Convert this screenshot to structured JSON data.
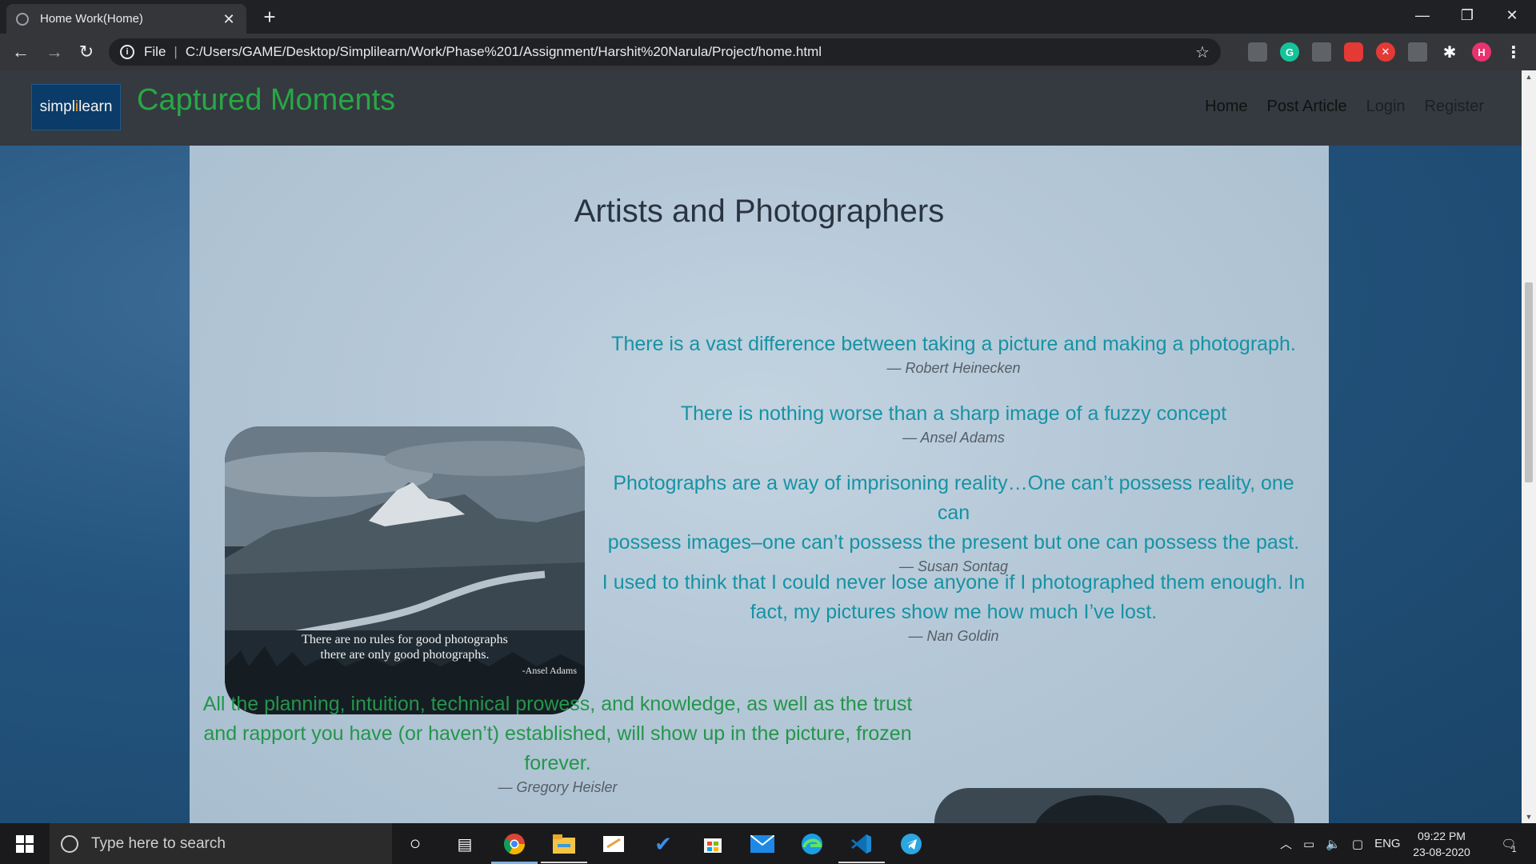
{
  "browser": {
    "tab_title": "Home Work(Home)",
    "tab_close": "✕",
    "new_tab": "+",
    "url_scheme": "File",
    "url": "C:/Users/GAME/Desktop/Simplilearn/Work/Phase%201/Assignment/Harshit%20Narula/Project/home.html",
    "profile_initial": "H",
    "minimize": "—",
    "restore": "❐",
    "close": "✕"
  },
  "site": {
    "logo_text_a": "simpl",
    "logo_text_b": "i",
    "logo_text_c": "learn",
    "brand": "Captured Moments",
    "nav": [
      {
        "label": "Home"
      },
      {
        "label": "Post Article"
      },
      {
        "label": "Login"
      },
      {
        "label": "Register"
      }
    ]
  },
  "main": {
    "title": "Artists and Photographers",
    "photo1_quote_line1": "There are no rules for good photographs",
    "photo1_quote_line2": "there are only good photographs.",
    "photo1_author": "-Ansel Adams",
    "quotes": [
      {
        "text": "There is a vast difference between taking a picture and making a photograph.",
        "cite": "— Robert Heinecken"
      },
      {
        "text": "There is nothing worse than a sharp image of a fuzzy concept",
        "cite": "— Ansel Adams"
      },
      {
        "text_line1": "Photographs are a way of imprisoning reality…One can’t possess reality, one can",
        "text_line2": "possess images–one can’t possess the present but one can possess the past.",
        "cite": "— Susan Sontag"
      },
      {
        "text_line1": "I used to think that I could never lose anyone if I photographed them enough. In",
        "text_line2": "fact, my pictures show me how much I’ve lost.",
        "cite": "— Nan Goldin"
      },
      {
        "text_line1": "All the planning, intuition, technical prowess, and knowledge, as well as the trust",
        "text_line2": "and rapport you have (or haven’t) established, will show up in the picture, frozen",
        "text_line3": "forever.",
        "cite": "— Gregory Heisler"
      }
    ]
  },
  "taskbar": {
    "search_placeholder": "Type here to search",
    "lang": "ENG",
    "time": "09:22 PM",
    "date": "23-08-2020",
    "notifications": "1"
  },
  "colors": {
    "brand_green": "#28a745",
    "quote_teal": "#1593a4",
    "quote_green": "#23964a",
    "navbar_bg": "#343a40"
  }
}
